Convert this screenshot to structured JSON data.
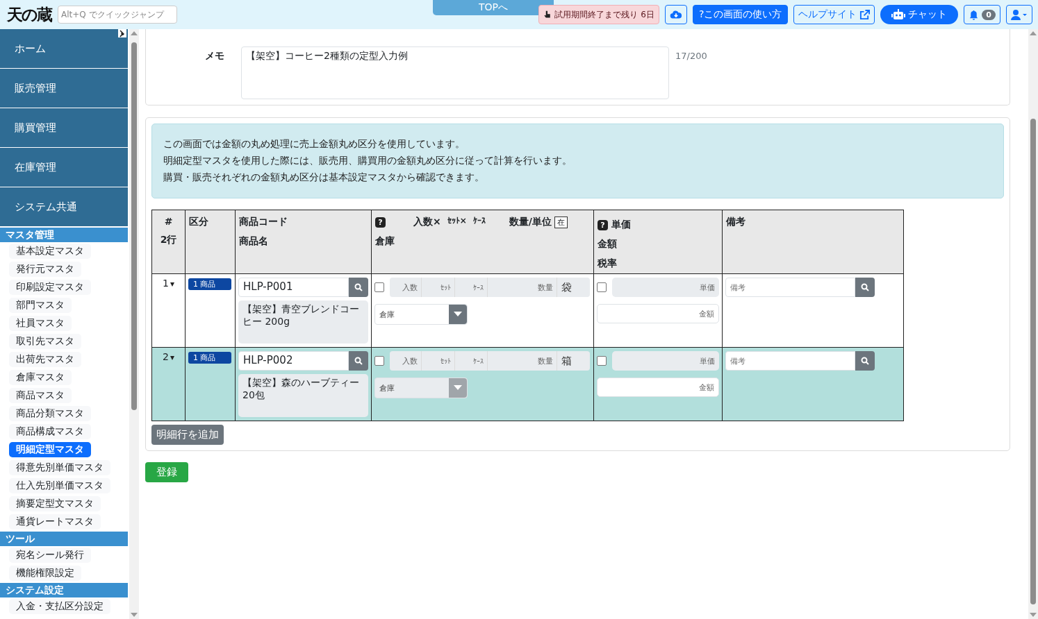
{
  "header": {
    "logo": "天の蔵",
    "quick_jump": {
      "placeholder": "Alt+Q でクイックジャンプ"
    },
    "top_button": "TOPへ",
    "trial_badge": "試用期間終了まで残り 6日",
    "help_button": "?この画面の使い方",
    "help_site_button": "ヘルプサイト",
    "chat_button": "チャット",
    "notification_count": "0"
  },
  "sidebar": {
    "nav": [
      {
        "label": "ホーム"
      },
      {
        "label": "販売管理"
      },
      {
        "label": "購買管理"
      },
      {
        "label": "在庫管理"
      },
      {
        "label": "システム共通"
      }
    ],
    "sections": [
      {
        "title": "マスタ管理",
        "items": [
          {
            "label": "基本設定マスタ",
            "selected": false
          },
          {
            "label": "発行元マスタ",
            "selected": false
          },
          {
            "label": "印刷設定マスタ",
            "selected": false
          },
          {
            "label": "部門マスタ",
            "selected": false
          },
          {
            "label": "社員マスタ",
            "selected": false
          },
          {
            "label": "取引先マスタ",
            "selected": false
          },
          {
            "label": "出荷先マスタ",
            "selected": false
          },
          {
            "label": "倉庫マスタ",
            "selected": false
          },
          {
            "label": "商品マスタ",
            "selected": false
          },
          {
            "label": "商品分類マスタ",
            "selected": false
          },
          {
            "label": "商品構成マスタ",
            "selected": false
          },
          {
            "label": "明細定型マスタ",
            "selected": true
          },
          {
            "label": "得意先別単価マスタ",
            "selected": false
          },
          {
            "label": "仕入先別単価マスタ",
            "selected": false
          },
          {
            "label": "摘要定型文マスタ",
            "selected": false
          },
          {
            "label": "通貨レートマスタ",
            "selected": false
          }
        ]
      },
      {
        "title": "ツール",
        "items": [
          {
            "label": "宛名シール発行",
            "selected": false
          },
          {
            "label": "機能権限設定",
            "selected": false
          }
        ]
      },
      {
        "title": "システム設定",
        "items": [
          {
            "label": "入金・支払区分設定",
            "selected": false
          }
        ]
      }
    ]
  },
  "form": {
    "memo": {
      "label": "メモ",
      "value": "【架空】コーヒー2種類の定型入力例",
      "counter": "17/200"
    }
  },
  "notice": [
    "この画面では金額の丸め処理に売上金額丸め区分を使用しています。",
    "明細定型マスタを使用した際には、販売用、購買用の金額丸め区分に従って計算を行います。",
    "購買・販売それぞれの金額丸め区分は基本設定マスタから確認できます。"
  ],
  "table": {
    "header": {
      "number": "#",
      "row_count": "2行",
      "category": "区分",
      "code": "商品コード",
      "name": "商品名",
      "help_mark": "?",
      "qty_parts": [
        "入数×",
        "ｾｯﾄ×",
        "ｹｰｽ"
      ],
      "qty_unit": "数量/単位",
      "stock_toggle": "在",
      "warehouse": "倉庫",
      "price_help_mark": "?",
      "price": "単価",
      "amount": "金額",
      "tax": "税率",
      "remarks": "備考"
    },
    "rows": [
      {
        "number": "1",
        "selected": false,
        "category": "1 商品",
        "code": "HLP-P001",
        "name": "【架空】青空ブレンドコーヒー 200g",
        "qty_checked": false,
        "qty_placeholders": [
          "入数",
          "ｾｯﾄ",
          "ｹｰｽ",
          "数量"
        ],
        "unit": "袋",
        "warehouse": {
          "placeholder": "倉庫",
          "disabled": false
        },
        "price_checked": false,
        "price_placeholder": "単価",
        "amount_placeholder": "金額",
        "remarks_placeholder": "備考"
      },
      {
        "number": "2",
        "selected": true,
        "category": "1 商品",
        "code": "HLP-P002",
        "name": "【架空】森のハーブティー 20包",
        "qty_checked": false,
        "qty_placeholders": [
          "入数",
          "ｾｯﾄ",
          "ｹｰｽ",
          "数量"
        ],
        "unit": "箱",
        "warehouse": {
          "placeholder": "倉庫",
          "disabled": true
        },
        "price_checked": false,
        "price_placeholder": "単価",
        "amount_placeholder": "金額",
        "remarks_placeholder": "備考"
      }
    ]
  },
  "add_row_button": "明細行を追加",
  "submit_button": "登録"
}
